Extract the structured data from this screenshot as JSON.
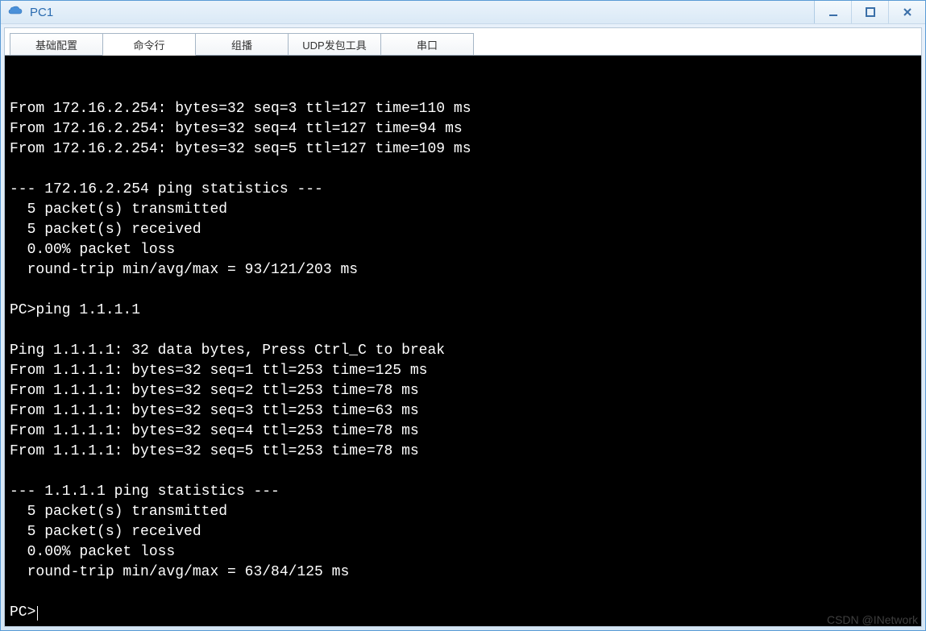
{
  "window": {
    "title": "PC1"
  },
  "tabs": [
    {
      "label": "基础配置"
    },
    {
      "label": "命令行"
    },
    {
      "label": "组播"
    },
    {
      "label": "UDP发包工具"
    },
    {
      "label": "串口"
    }
  ],
  "active_tab_index": 1,
  "terminal_lines": [
    "From 172.16.2.254: bytes=32 seq=3 ttl=127 time=110 ms",
    "From 172.16.2.254: bytes=32 seq=4 ttl=127 time=94 ms",
    "From 172.16.2.254: bytes=32 seq=5 ttl=127 time=109 ms",
    "",
    "--- 172.16.2.254 ping statistics ---",
    "  5 packet(s) transmitted",
    "  5 packet(s) received",
    "  0.00% packet loss",
    "  round-trip min/avg/max = 93/121/203 ms",
    "",
    "PC>ping 1.1.1.1",
    "",
    "Ping 1.1.1.1: 32 data bytes, Press Ctrl_C to break",
    "From 1.1.1.1: bytes=32 seq=1 ttl=253 time=125 ms",
    "From 1.1.1.1: bytes=32 seq=2 ttl=253 time=78 ms",
    "From 1.1.1.1: bytes=32 seq=3 ttl=253 time=63 ms",
    "From 1.1.1.1: bytes=32 seq=4 ttl=253 time=78 ms",
    "From 1.1.1.1: bytes=32 seq=5 ttl=253 time=78 ms",
    "",
    "--- 1.1.1.1 ping statistics ---",
    "  5 packet(s) transmitted",
    "  5 packet(s) received",
    "  0.00% packet loss",
    "  round-trip min/avg/max = 63/84/125 ms",
    ""
  ],
  "prompt": "PC>",
  "watermark": "CSDN @INetwork"
}
